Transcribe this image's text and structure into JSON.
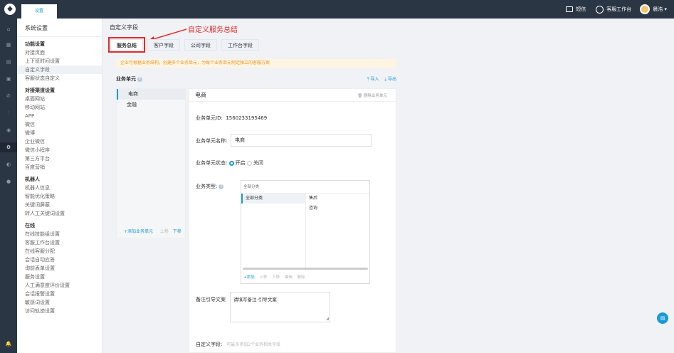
{
  "topbar": {
    "tab": "设置",
    "sms": "短信",
    "workbench": "客服工作台",
    "user": "晨浩 ▾",
    "logo_glyph": "◆"
  },
  "leftbar": {
    "icons": [
      "⌂",
      "▦",
      "▤",
      "▣",
      "✆",
      "⫶",
      "◉",
      "⚙",
      "◐",
      "●",
      "🔔"
    ]
  },
  "sidebar": {
    "title": "系统设置",
    "groups": [
      {
        "label": "功能设置",
        "items": [
          "对接页面",
          "上下班时间设置",
          "自定义字段",
          "客服状态自定义"
        ],
        "selected": 2
      },
      {
        "label": "对接渠道设置",
        "items": [
          "桌面网站",
          "移动网站",
          "APP",
          "微信",
          "微博",
          "企业微信",
          "微信小程序",
          "第三方平台",
          "百度营销"
        ],
        "selected": -1
      },
      {
        "label": "机器人",
        "items": [
          "机器人信息",
          "智能优化策略",
          "关键词屏蔽",
          "转人工关键词设置"
        ],
        "selected": -1
      },
      {
        "label": "在线",
        "items": [
          "在线技能组设置",
          "客服工作台设置",
          "在线客服分配",
          "会话自动应答",
          "询前表单设置",
          "服务设置",
          "人工满意度评价设置",
          "会话报警设置",
          "敏感词设置",
          "访问轨迹设置"
        ],
        "selected": -1
      }
    ]
  },
  "main": {
    "title": "自定义字段",
    "annotation": "自定义服务总结",
    "tabs": [
      "服务总结",
      "客户字段",
      "公司字段",
      "工作台字段"
    ],
    "active_tab": 0,
    "notice": "企业可根据业务结构，创建多个业务单元，为每个业务单元制定独立的客服方案",
    "bu_label": "业务单元",
    "import": "导入",
    "export": "导出",
    "units": [
      "电商",
      "金融"
    ],
    "unit_add": "+添加业务单元",
    "unit_up": "上移",
    "unit_down": "下移",
    "detail": {
      "name": "电商",
      "delete": "删除业务单元",
      "id_label": "业务单元ID:",
      "id_value": "1560233195469",
      "name_label": "业务单元名称:",
      "name_value": "电商",
      "status_label": "业务单元状态:",
      "status_on": "开启",
      "status_off": "关闭",
      "type_label": "业务类型:",
      "type_head": "全部分类",
      "type_left": [
        "全部分类"
      ],
      "type_right": [
        "售后",
        "咨询"
      ],
      "type_add": "+添加",
      "type_up": "上移",
      "type_down": "下移",
      "type_edit": "编辑",
      "type_del": "删除",
      "note_label": "备注引导文案",
      "note_value": "请填写备注-引导文案",
      "custom_label": "自定义字段:",
      "custom_hint": "可最多添加2个业务相关字段"
    }
  },
  "float_glyph": "▤"
}
